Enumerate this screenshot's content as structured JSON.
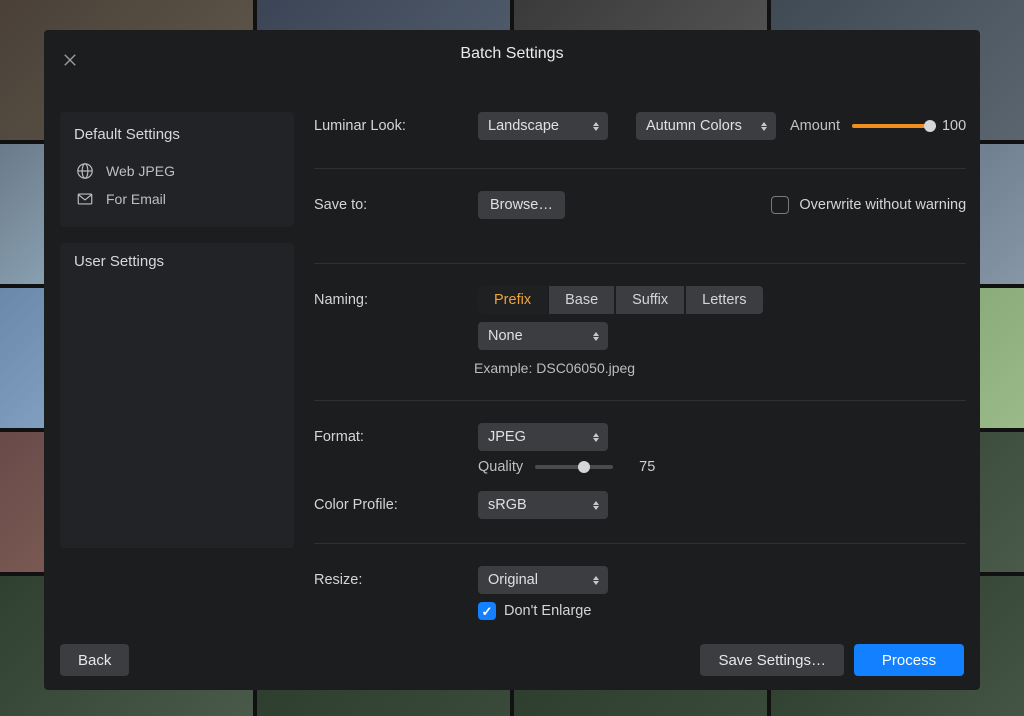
{
  "header": {
    "title": "Batch Settings"
  },
  "sidebar": {
    "default_heading": "Default Settings",
    "default_items": [
      {
        "icon": "globe-icon",
        "label": "Web JPEG"
      },
      {
        "icon": "envelope-icon",
        "label": "For Email"
      }
    ],
    "user_heading": "User Settings"
  },
  "look": {
    "label": "Luminar Look:",
    "preset": "Landscape",
    "filter": "Autumn Colors",
    "amount_label": "Amount",
    "amount_value": "100",
    "amount_pct": 100
  },
  "save": {
    "label": "Save to:",
    "browse": "Browse…",
    "overwrite_label": "Overwrite without warning",
    "overwrite_checked": false
  },
  "naming": {
    "label": "Naming:",
    "tabs": [
      "Prefix",
      "Base",
      "Suffix",
      "Letters"
    ],
    "active_tab": 0,
    "option": "None",
    "example_prefix": "Example: ",
    "example": "DSC06050.jpeg"
  },
  "format": {
    "label": "Format:",
    "value": "JPEG",
    "quality_label": "Quality",
    "quality_value": "75",
    "quality_pct": 62
  },
  "color": {
    "label": "Color Profile:",
    "value": "sRGB"
  },
  "resize": {
    "label": "Resize:",
    "value": "Original",
    "dont_enlarge_label": "Don't Enlarge",
    "dont_enlarge_checked": true
  },
  "footer": {
    "back": "Back",
    "save_settings": "Save Settings…",
    "process": "Process"
  }
}
